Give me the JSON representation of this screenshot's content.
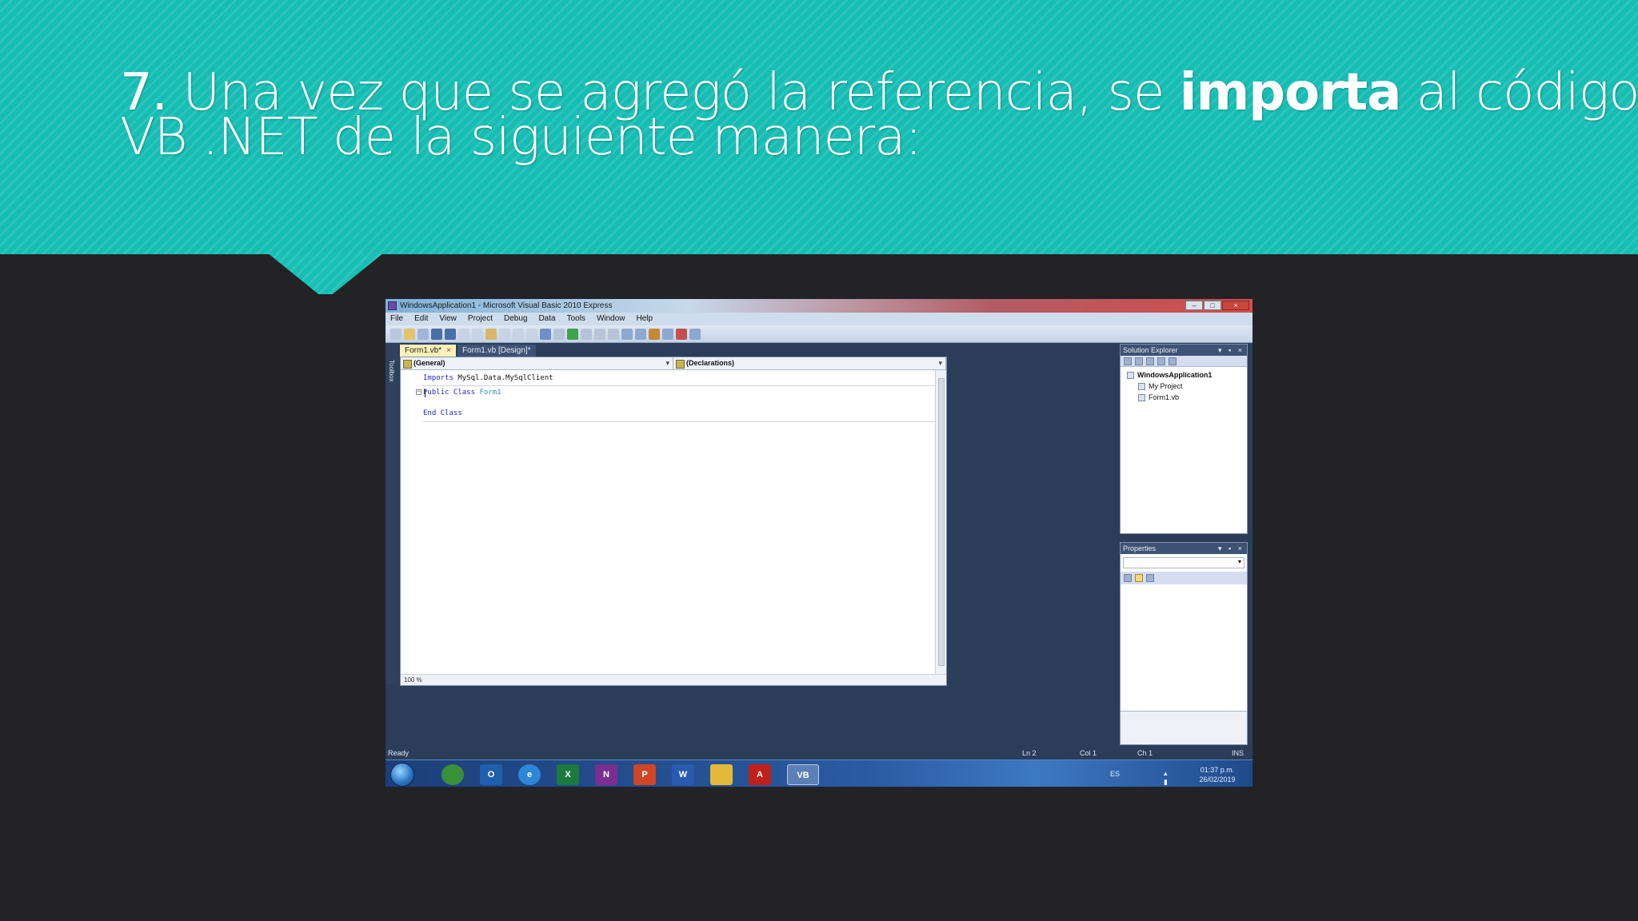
{
  "slide": {
    "title_number": "7.",
    "title_part1": " Una vez que se agregó la referencia, se ",
    "title_bold": "importa",
    "title_part2": " al código de",
    "title_line2": "VB .NET de la siguiente manera:"
  },
  "colors": {
    "header_teal": "#15bdb3",
    "background_dark": "#232325",
    "vs_blue": "#2c3d5a",
    "active_tab": "#fff2b8"
  },
  "ide": {
    "window_title": "WindowsApplication1 - Microsoft Visual Basic 2010 Express",
    "menu": [
      "File",
      "Edit",
      "View",
      "Project",
      "Debug",
      "Data",
      "Tools",
      "Window",
      "Help"
    ],
    "toolbox_label": "Toolbox",
    "tabs": [
      {
        "label": "Form1.vb*",
        "active": true
      },
      {
        "label": "Form1.vb [Design]*",
        "active": false
      }
    ],
    "combo_left": "(General)",
    "combo_right": "(Declarations)",
    "code": {
      "imports_kw": "Imports",
      "imports_ns": " MySql.Data.MySqlClient",
      "public_class_kw": "Public Class",
      "class_name": " Form1",
      "end_class_kw": "End Class"
    },
    "zoom": "100 %",
    "solution_explorer": {
      "title": "Solution Explorer",
      "items": [
        "WindowsApplication1",
        "My Project",
        "Form1.vb"
      ]
    },
    "properties": {
      "title": "Properties"
    },
    "status": {
      "ready": "Ready",
      "ln": "Ln 2",
      "col": "Col 1",
      "ch": "Ch 1",
      "ins": "INS"
    }
  },
  "taskbar": {
    "apps": [
      {
        "icon": "chrome-icon",
        "label": "",
        "color": "#3a8f3a"
      },
      {
        "icon": "outlook-icon",
        "label": "O",
        "color": "#1f5fb0"
      },
      {
        "icon": "ie-icon",
        "label": "e",
        "color": "#2d86d6"
      },
      {
        "icon": "excel-icon",
        "label": "X",
        "color": "#1d7a3e"
      },
      {
        "icon": "onenote-icon",
        "label": "N",
        "color": "#7a2e8f"
      },
      {
        "icon": "powerpoint-icon",
        "label": "P",
        "color": "#d04525"
      },
      {
        "icon": "word-icon",
        "label": "W",
        "color": "#2b5bb0"
      },
      {
        "icon": "explorer-icon",
        "label": "",
        "color": "#e4b93a"
      },
      {
        "icon": "acrobat-icon",
        "label": "A",
        "color": "#c0201c"
      },
      {
        "icon": "visual-basic-icon",
        "label": "VB",
        "color": "#5c7fb6"
      }
    ],
    "language": "ES",
    "time": "01:37 p.m.",
    "date": "26/02/2019"
  }
}
